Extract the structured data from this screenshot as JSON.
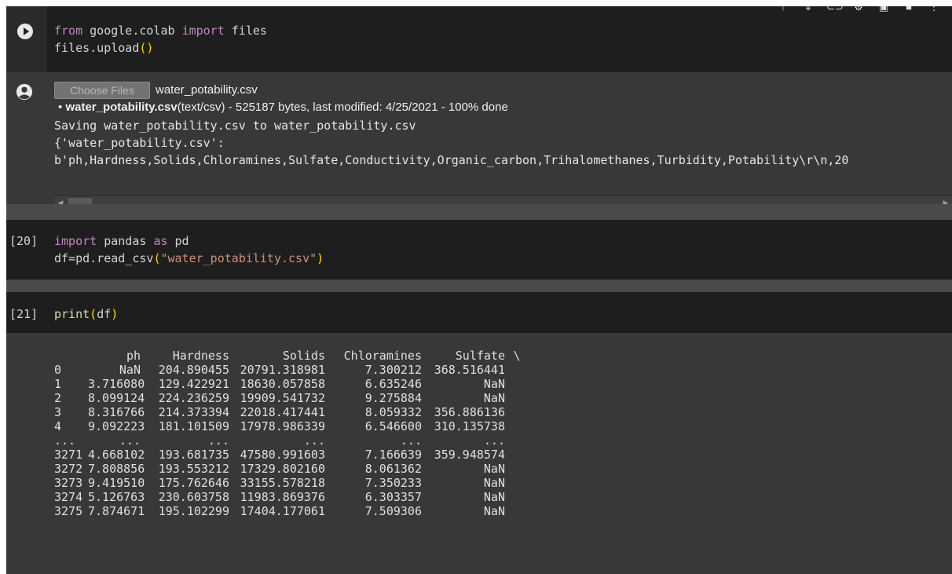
{
  "cell_upload": {
    "code_line1": {
      "kw_from": "from",
      "mod": " google.colab ",
      "kw_import": "import",
      "rest": " files"
    },
    "code_line2": {
      "pre": "files.upload",
      "paren": "()"
    },
    "run_icon": "play-circle-icon"
  },
  "toolbar": {
    "icons": [
      "arrow-up-icon",
      "arrow-down-icon",
      "link-icon",
      "gear-icon",
      "mirror-cell-icon",
      "delete-icon",
      "more-vert-icon"
    ]
  },
  "upload_output": {
    "avatar_icon": "account-circle-icon",
    "choose_files_label": "Choose Files",
    "chosen_file": "water_potability.csv",
    "bullet": "•",
    "file_name_bold": "water_potability.csv",
    "file_details": "(text/csv) - 525187 bytes, last modified: 4/25/2021 - 100% done",
    "line_saving": "Saving water_potability.csv to water_potability.csv",
    "line_dict": "{'water_potability.csv':",
    "line_bytes": "b'ph,Hardness,Solids,Chloramines,Sulfate,Conductivity,Organic_carbon,Trihalomethanes,Turbidity,Potability\\r\\n,20"
  },
  "cell_20": {
    "exec_count": "[20]",
    "line1": {
      "kw_import": "import",
      "mid": " pandas ",
      "kw_as": "as",
      "rest": " pd"
    },
    "line2": {
      "pre": "df=pd.read_csv",
      "open": "(",
      "str": "\"water_potability.csv\"",
      "close": ")"
    }
  },
  "cell_21": {
    "exec_count": "[21]",
    "fn": "print",
    "open": "(",
    "arg": "df",
    "close": ")"
  },
  "dataframe": {
    "header": [
      "",
      "ph",
      "Hardness",
      "Solids",
      "Chloramines",
      "Sulfate",
      "\\"
    ],
    "rows": [
      [
        "0",
        "NaN",
        "204.890455",
        "20791.318981",
        "7.300212",
        "368.516441"
      ],
      [
        "1",
        "3.716080",
        "129.422921",
        "18630.057858",
        "6.635246",
        "NaN"
      ],
      [
        "2",
        "8.099124",
        "224.236259",
        "19909.541732",
        "9.275884",
        "NaN"
      ],
      [
        "3",
        "8.316766",
        "214.373394",
        "22018.417441",
        "8.059332",
        "356.886136"
      ],
      [
        "4",
        "9.092223",
        "181.101509",
        "17978.986339",
        "6.546600",
        "310.135738"
      ],
      [
        "...",
        "...",
        "...",
        "...",
        "...",
        "..."
      ],
      [
        "3271",
        "4.668102",
        "193.681735",
        "47580.991603",
        "7.166639",
        "359.948574"
      ],
      [
        "3272",
        "7.808856",
        "193.553212",
        "17329.802160",
        "8.061362",
        "NaN"
      ],
      [
        "3273",
        "9.419510",
        "175.762646",
        "33155.578218",
        "7.350233",
        "NaN"
      ],
      [
        "3274",
        "5.126763",
        "230.603758",
        "11983.869376",
        "6.303357",
        "NaN"
      ],
      [
        "3275",
        "7.874671",
        "195.102299",
        "17404.177061",
        "7.509306",
        "NaN"
      ]
    ]
  }
}
